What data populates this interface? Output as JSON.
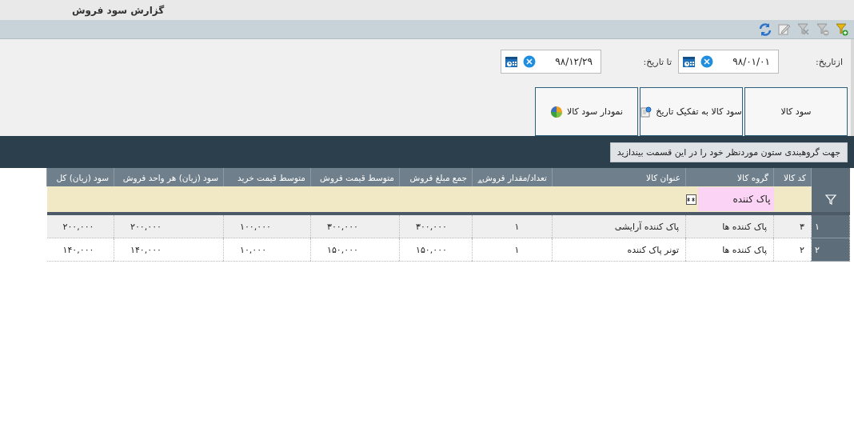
{
  "window": {
    "title": "گزارش سود فروش"
  },
  "toolbar": [
    {
      "kind": "filter-add",
      "disabled": false
    },
    {
      "kind": "filter-remove",
      "disabled": true
    },
    {
      "kind": "filter-clear",
      "disabled": true
    },
    {
      "kind": "edit",
      "disabled": true
    },
    {
      "kind": "refresh",
      "disabled": false
    }
  ],
  "date_range": [
    {
      "label": "ازتاریخ:",
      "value": "۹۸/۰۱/۰۱"
    },
    {
      "label": "تا تاریخ:",
      "value": "۹۸/۱۲/۲۹"
    }
  ],
  "report_buttons": [
    {
      "label": "سود کالا",
      "kind": "plain"
    },
    {
      "label": "سود کالا به تفکیک تاریخ",
      "kind": "date"
    },
    {
      "label": "نمودار سود کالا",
      "kind": "chart"
    }
  ],
  "group_panel": {
    "text": "جهت گروهبندی ستون موردنظر خود را در این قسمت بیندازید"
  },
  "table": {
    "columns": [
      {
        "label": "کد کالا",
        "sorted": false
      },
      {
        "label": "گروه کالا",
        "sorted": false,
        "filter": "پاک کننده"
      },
      {
        "label": "عنوان کالا",
        "sorted": false
      },
      {
        "label": "تعداد/مقدار فروش",
        "sorted": true
      },
      {
        "label": "جمع مبلغ فروش",
        "sorted": false
      },
      {
        "label": "متوسط قیمت فروش",
        "sorted": false
      },
      {
        "label": "متوسط قیمت خرید",
        "sorted": false
      },
      {
        "label": "سود (زیان) هر واحد فروش",
        "sorted": false
      },
      {
        "label": "سود (زیان) کل",
        "sorted": false
      }
    ],
    "rows": [
      {
        "number": "۱",
        "cells": [
          "۳",
          "پاک کننده ها",
          "پاک کننده آرایشی",
          "۱",
          "۳۰۰,۰۰۰",
          "۳۰۰,۰۰۰",
          "۱۰۰,۰۰۰",
          "۲۰۰,۰۰۰",
          "۲۰۰,۰۰۰"
        ]
      },
      {
        "number": "۲",
        "cells": [
          "۲",
          "پاک کننده ها",
          "تونر پاک کننده",
          "۱",
          "۱۵۰,۰۰۰",
          "۱۵۰,۰۰۰",
          "۱۰,۰۰۰",
          "۱۴۰,۰۰۰",
          "۱۴۰,۰۰۰"
        ]
      }
    ]
  }
}
